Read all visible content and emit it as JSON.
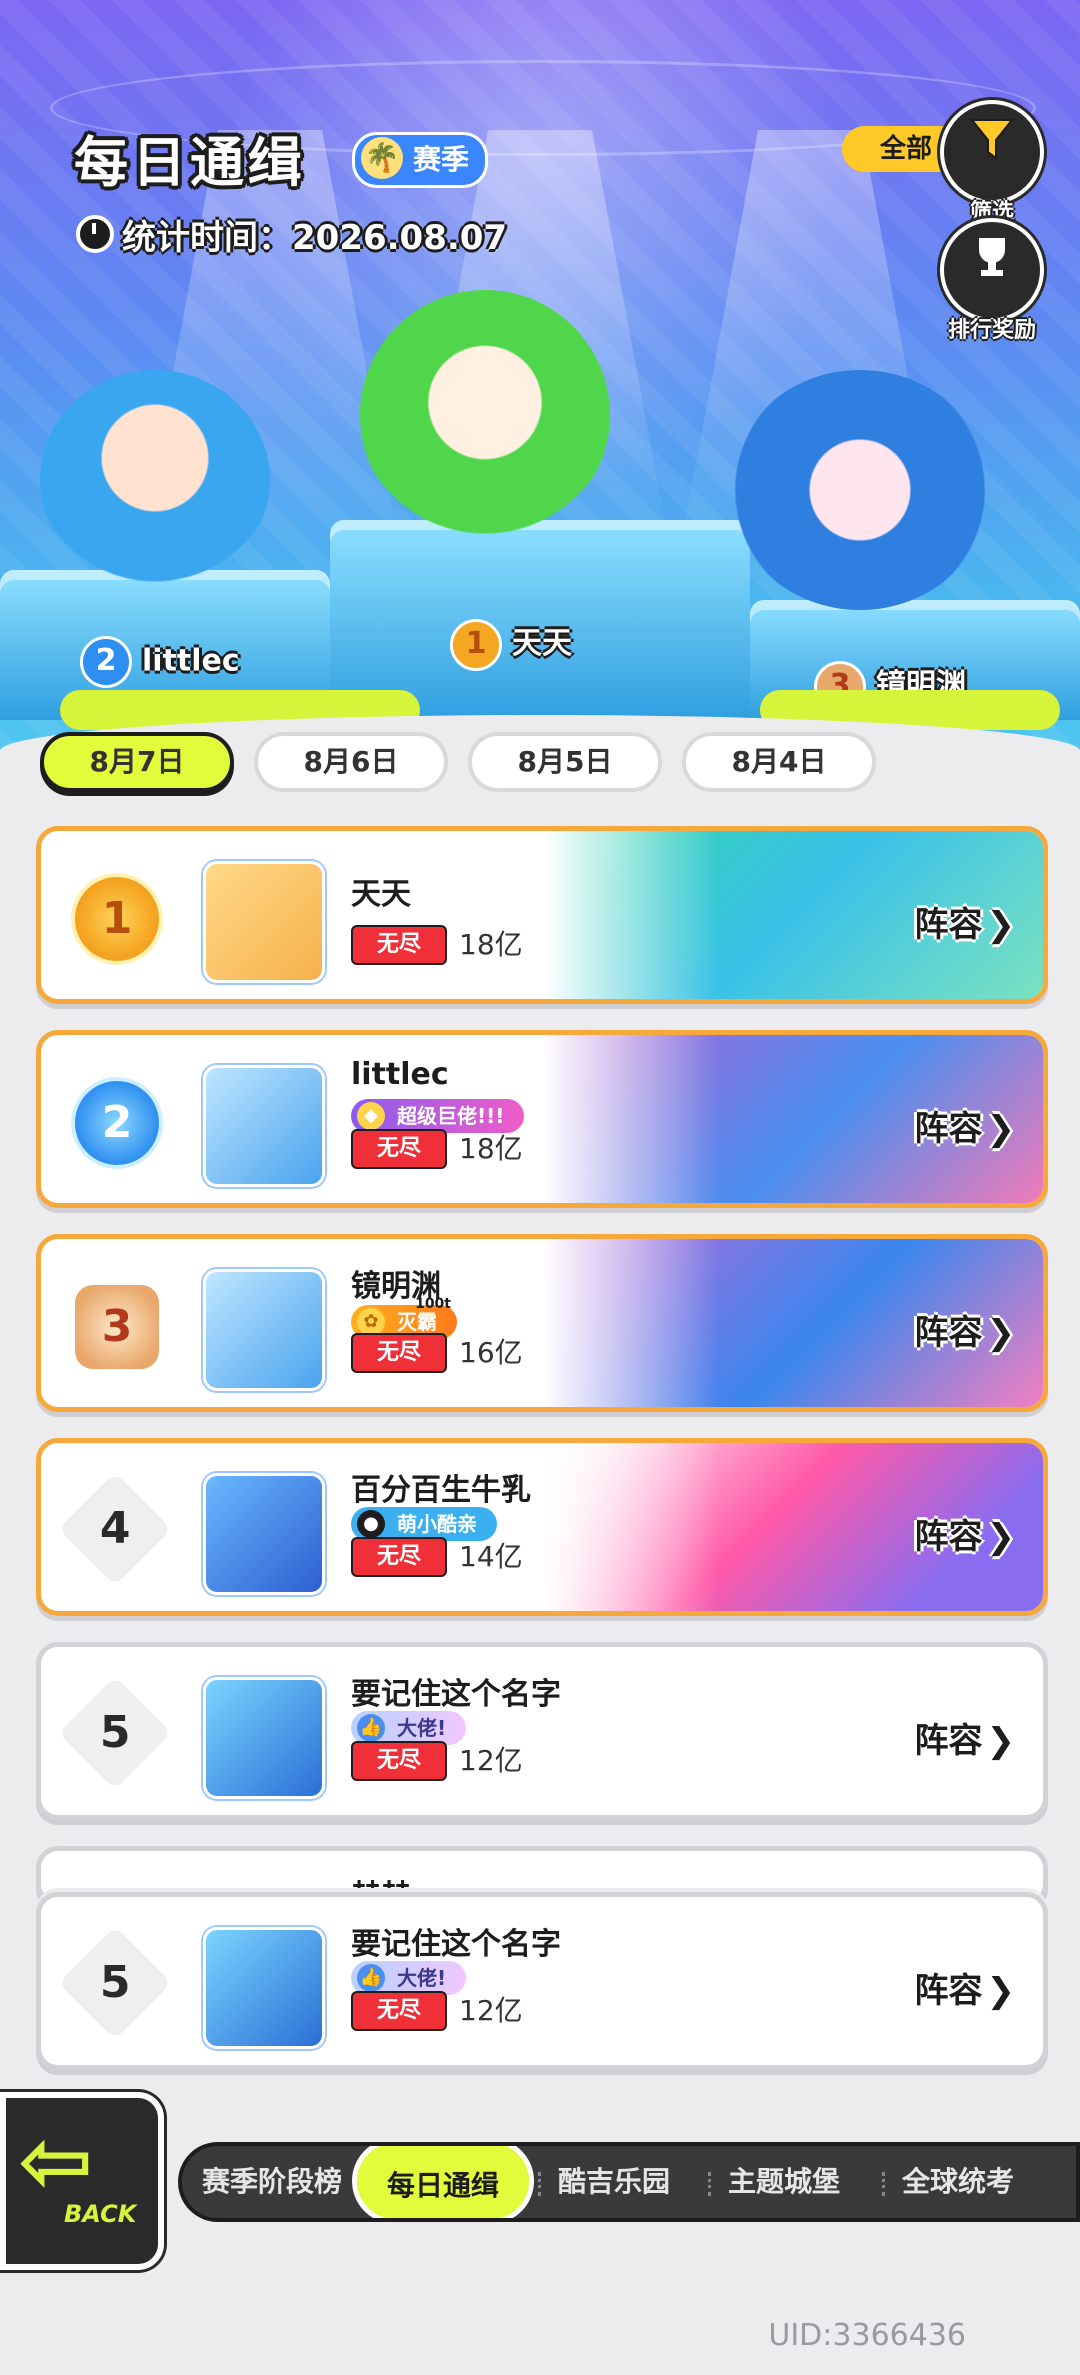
{
  "header": {
    "title": "每日通缉",
    "season_label": "赛季",
    "stat_time": "统计时间：2026.08.07",
    "filter_label": "全部",
    "filter_button_label": "筛选",
    "reward_button_label": "排行奖励"
  },
  "podium": [
    {
      "rank": "1",
      "name": "天天"
    },
    {
      "rank": "2",
      "name": "littlec"
    },
    {
      "rank": "3",
      "name": "镜明渊"
    }
  ],
  "date_tabs": [
    {
      "label": "8月7日",
      "active": true
    },
    {
      "label": "8月6日"
    },
    {
      "label": "8月5日"
    },
    {
      "label": "8月4日"
    }
  ],
  "rankings": [
    {
      "rank": "1",
      "name": "天天",
      "mode": "无尽",
      "score": "18亿",
      "lineup": "阵容"
    },
    {
      "rank": "2",
      "name": "littlec",
      "tag": "超级巨佬!!!",
      "mode": "无尽",
      "score": "18亿",
      "lineup": "阵容"
    },
    {
      "rank": "3",
      "name": "镜明渊",
      "tag": "灭霸",
      "tag_top": "100t",
      "mode": "无尽",
      "score": "16亿",
      "lineup": "阵容"
    },
    {
      "rank": "4",
      "name": "百分百生牛乳",
      "tag": "萌小酷亲",
      "mode": "无尽",
      "score": "14亿",
      "lineup": "阵容"
    },
    {
      "rank": "5",
      "name": "要记住这个名字",
      "tag": "大佬!",
      "mode": "无尽",
      "score": "12亿",
      "lineup": "阵容"
    }
  ],
  "partial_row_name": "赫赫",
  "my_rank": {
    "rank": "5",
    "name": "要记住这个名字",
    "tag": "大佬!",
    "mode": "无尽",
    "score": "12亿",
    "lineup": "阵容"
  },
  "bottom_nav": {
    "back_label": "BACK",
    "tabs": [
      "赛季阶段榜",
      "每日通缉",
      "酷吉乐园",
      "主题城堡",
      "全球统考"
    ]
  },
  "uid": "UID:3366436",
  "colors": {
    "accent": "#e2fb3a",
    "gold_border": "#f6a93a",
    "mode_red": "#ef3038"
  },
  "icons": {
    "clock": "clock-icon",
    "filter": "funnel-icon",
    "reward": "trophy-icon",
    "back": "arrow-left-icon",
    "chevron": "chevron-right-icon"
  }
}
